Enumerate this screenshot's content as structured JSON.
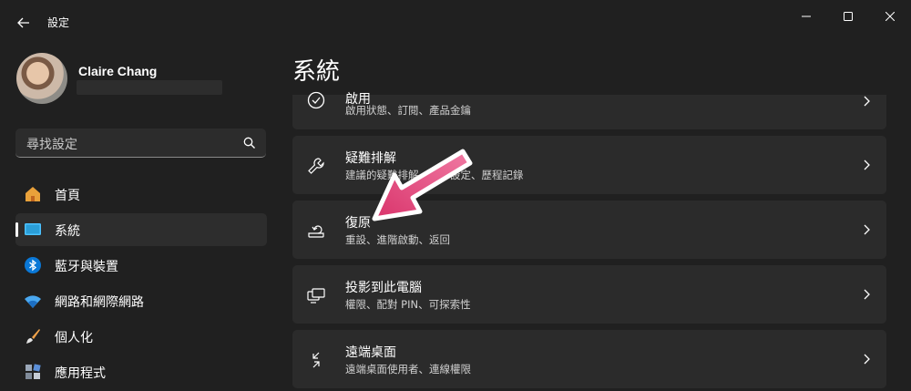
{
  "window": {
    "title": "設定"
  },
  "user": {
    "name": "Claire Chang"
  },
  "search": {
    "placeholder": "尋找設定"
  },
  "nav": {
    "items": [
      {
        "label": "首頁",
        "icon": "home-icon"
      },
      {
        "label": "系統",
        "icon": "system-icon",
        "selected": true
      },
      {
        "label": "藍牙與裝置",
        "icon": "bluetooth-icon"
      },
      {
        "label": "網路和網際網路",
        "icon": "wifi-icon"
      },
      {
        "label": "個人化",
        "icon": "brush-icon"
      },
      {
        "label": "應用程式",
        "icon": "apps-icon"
      }
    ]
  },
  "main": {
    "title": "系統",
    "cards": [
      {
        "title": "啟用",
        "desc": "啟用狀態、訂閱、產品金鑰",
        "icon": "activation-icon"
      },
      {
        "title": "疑難排解",
        "desc": "建議的疑難排解、喜好設定、歷程記錄",
        "icon": "wrench-icon"
      },
      {
        "title": "復原",
        "desc": "重設、進階啟動、返回",
        "icon": "recovery-icon"
      },
      {
        "title": "投影到此電腦",
        "desc": "權限、配對 PIN、可探索性",
        "icon": "project-icon"
      },
      {
        "title": "遠端桌面",
        "desc": "遠端桌面使用者、連線權限",
        "icon": "remote-desktop-icon"
      }
    ]
  },
  "colors": {
    "background": "#202020",
    "card": "#2b2b2b",
    "accent_arrow": "#e8487e"
  }
}
